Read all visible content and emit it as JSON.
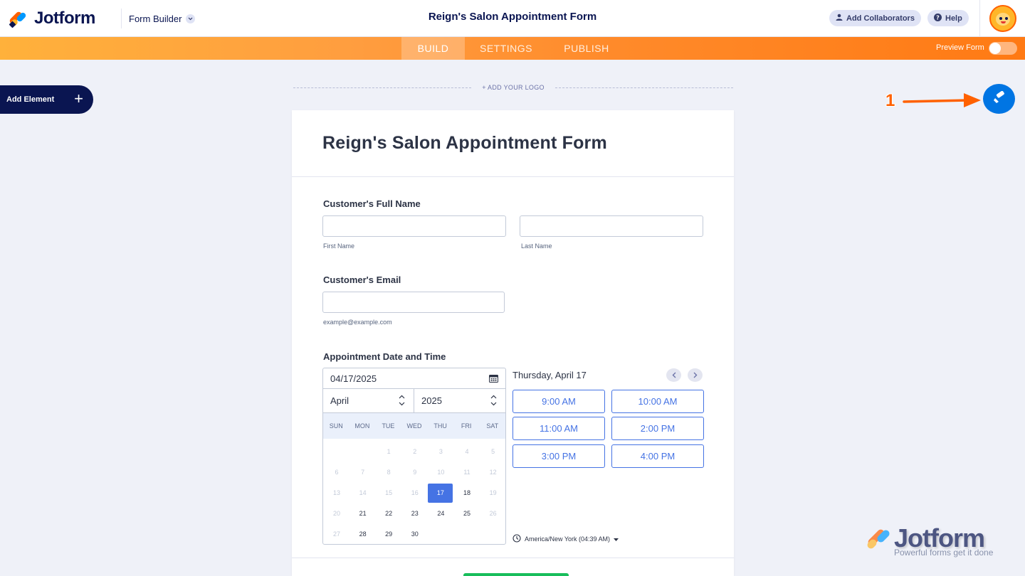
{
  "app": {
    "brand": "Jotform",
    "builder_menu": "Form Builder",
    "form_title": "Reign's Salon Appointment Form"
  },
  "header": {
    "add_collaborators": "Add Collaborators",
    "help": "Help"
  },
  "nav": {
    "tabs": [
      "BUILD",
      "SETTINGS",
      "PUBLISH"
    ],
    "active_tab": "BUILD",
    "preview_label": "Preview Form",
    "preview_on": false
  },
  "sidebar": {
    "add_element": "Add Element"
  },
  "canvas": {
    "add_logo": "+ ADD YOUR LOGO",
    "annotation_number": "1"
  },
  "form": {
    "title": "Reign's Salon Appointment Form",
    "name_field": {
      "label": "Customer's Full Name",
      "first": "First Name",
      "last": "Last Name"
    },
    "email_field": {
      "label": "Customer's Email",
      "hint": "example@example.com"
    },
    "appointment": {
      "label": "Appointment Date and Time",
      "date_value": "04/17/2025",
      "month": "April",
      "year": "2025",
      "weekdays": [
        "SUN",
        "MON",
        "TUE",
        "WED",
        "THU",
        "FRI",
        "SAT"
      ],
      "days": [
        [
          null,
          null,
          "1",
          "2",
          "3",
          "4",
          "5"
        ],
        [
          "6",
          "7",
          "8",
          "9",
          "10",
          "11",
          "12"
        ],
        [
          "13",
          "14",
          "15",
          "16",
          "17",
          "18",
          "19"
        ],
        [
          "20",
          "21",
          "22",
          "23",
          "24",
          "25",
          "26"
        ],
        [
          "27",
          "28",
          "29",
          "30",
          null,
          null,
          null
        ]
      ],
      "selected_day": "17",
      "first_available_day": 17,
      "day_heading": "Thursday, April 17",
      "slots": [
        "9:00 AM",
        "10:00 AM",
        "11:00 AM",
        "2:00 PM",
        "3:00 PM",
        "4:00 PM"
      ],
      "timezone": "America/New York (04:39 AM)"
    }
  },
  "watermark": {
    "brand": "Jotform",
    "tagline": "Powerful forms get it done"
  },
  "colors": {
    "navy": "#0a1551",
    "orange": "#ff6100",
    "blue": "#0075e3",
    "slot_blue": "#4573e4",
    "green": "#18bd5b"
  }
}
